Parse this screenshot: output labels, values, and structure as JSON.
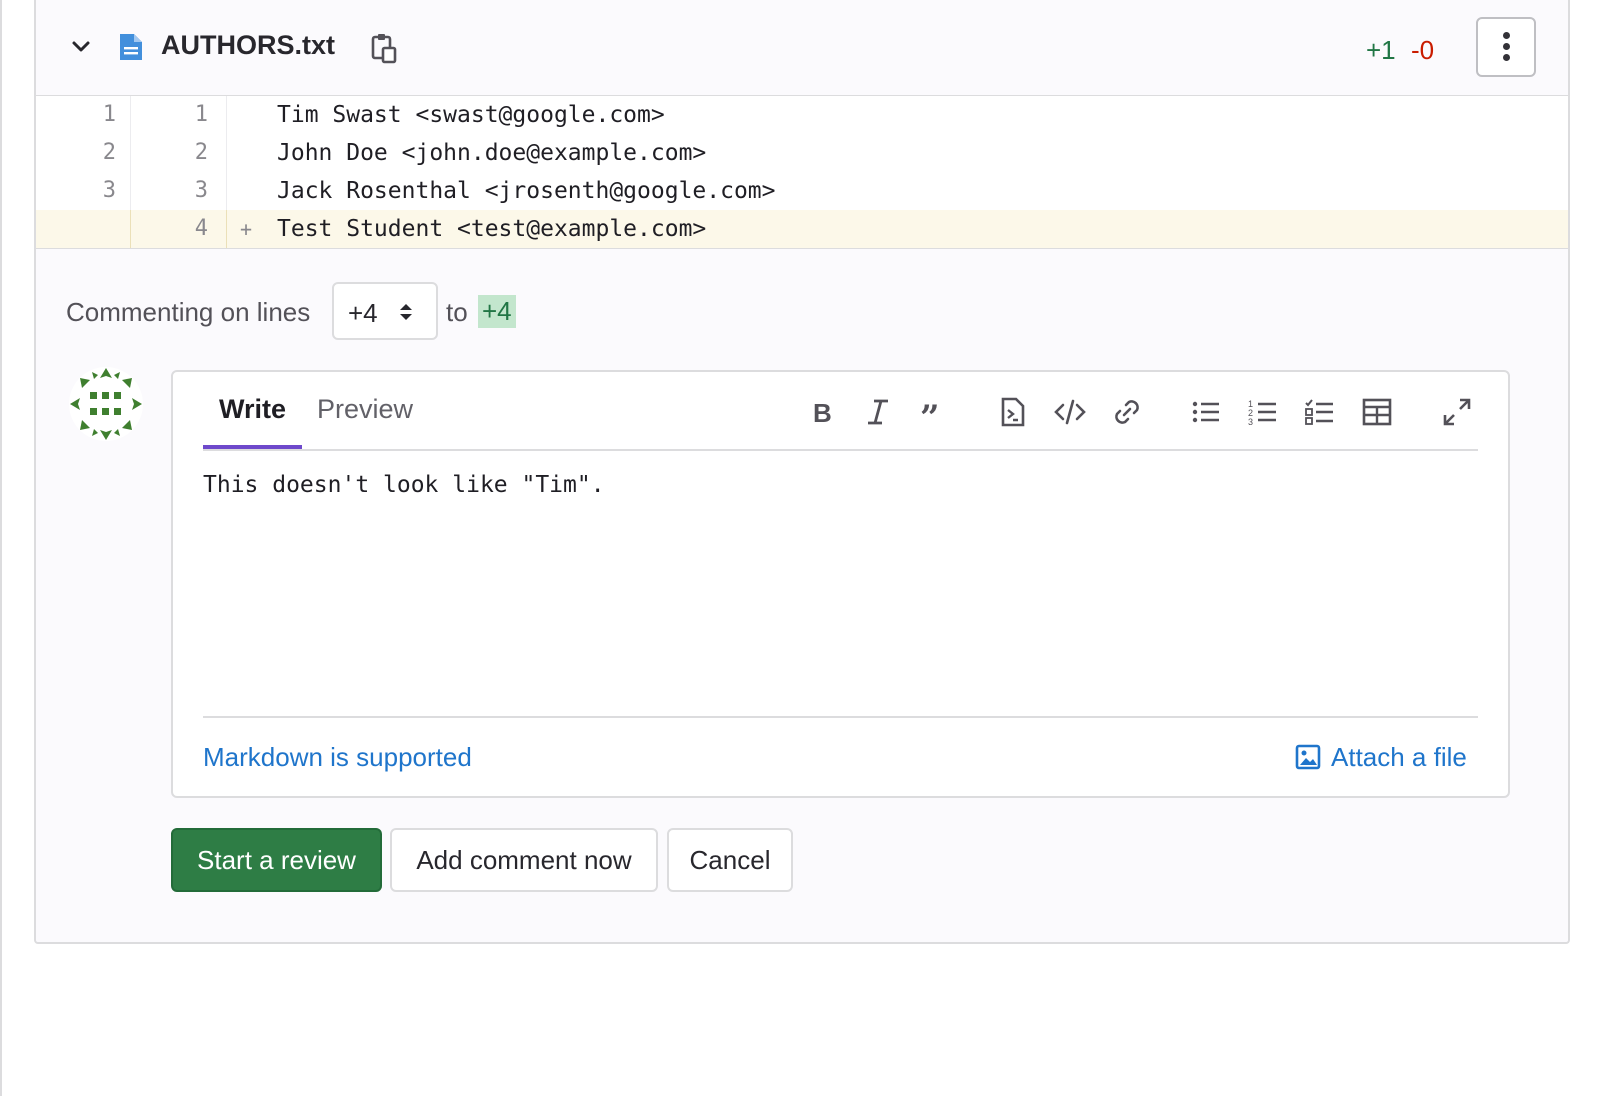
{
  "file": {
    "name": "AUTHORS.txt",
    "added": "+1",
    "removed": "-0"
  },
  "diff": {
    "lines": [
      {
        "old": "1",
        "new": "1",
        "marker": "",
        "code": "Tim Swast <swast@google.com>",
        "type": "context"
      },
      {
        "old": "2",
        "new": "2",
        "marker": "",
        "code": "John Doe <john.doe@example.com>",
        "type": "context"
      },
      {
        "old": "3",
        "new": "3",
        "marker": "",
        "code": "Jack Rosenthal <jrosenth@google.com>",
        "type": "context"
      },
      {
        "old": "",
        "new": "4",
        "marker": "+",
        "code": "Test Student <test@example.com>",
        "type": "added"
      }
    ]
  },
  "comment_range": {
    "label": "Commenting on lines",
    "start": "+4",
    "to": "to",
    "end": "+4"
  },
  "editor": {
    "tab_write": "Write",
    "tab_preview": "Preview",
    "text": "This doesn't look like \"Tim\".",
    "markdown_hint": "Markdown is supported",
    "attach_label": "Attach a file",
    "toolbar_icons": [
      "bold-icon",
      "italic-icon",
      "quote-icon",
      "suggestion-icon",
      "code-icon",
      "link-icon",
      "bullet-list-icon",
      "numbered-list-icon",
      "task-list-icon",
      "table-icon",
      "fullscreen-icon"
    ]
  },
  "actions": {
    "start_review": "Start a review",
    "add_comment": "Add comment now",
    "cancel": "Cancel"
  },
  "colors": {
    "added_green": "#217645",
    "removed_red": "#c91c00",
    "link_blue": "#1f75cb",
    "primary_button": "#2e7d45",
    "tab_underline": "#6e49cb",
    "added_row_bg": "#fcf8e9"
  }
}
